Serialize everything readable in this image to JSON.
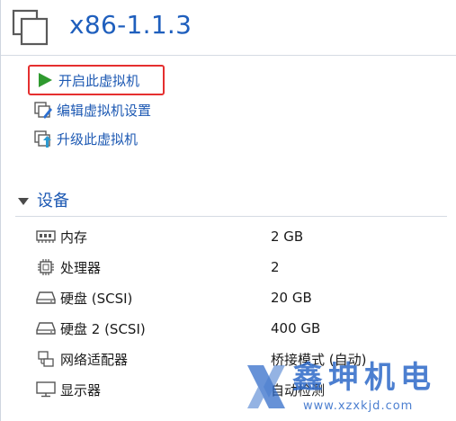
{
  "header": {
    "title": "x86-1.1.3",
    "icon": "vm-window-icon"
  },
  "actions": [
    {
      "label": "开启此虚拟机",
      "icon": "play-icon"
    },
    {
      "label": "编辑虚拟机设置",
      "icon": "edit-vm-icon"
    },
    {
      "label": "升级此虚拟机",
      "icon": "upgrade-vm-icon"
    }
  ],
  "devices": {
    "title": "设备",
    "items": [
      {
        "name": "内存",
        "value": "2 GB",
        "icon": "memory-icon"
      },
      {
        "name": "处理器",
        "value": "2",
        "icon": "cpu-icon"
      },
      {
        "name": "硬盘 (SCSI)",
        "value": "20 GB",
        "icon": "hard-disk-icon"
      },
      {
        "name": "硬盘 2 (SCSI)",
        "value": "400 GB",
        "icon": "hard-disk-icon"
      },
      {
        "name": "网络适配器",
        "value": "桥接模式 (自动)",
        "icon": "network-adapter-icon"
      },
      {
        "name": "显示器",
        "value": "自动检测",
        "icon": "display-icon"
      }
    ]
  },
  "watermark": {
    "brand": "鑫坤机电",
    "url": "www.xzxkjd.com"
  },
  "colors": {
    "accent_blue": "#1d59b3",
    "play_green": "#2f9a2f",
    "highlight_red": "#e52f2f"
  }
}
